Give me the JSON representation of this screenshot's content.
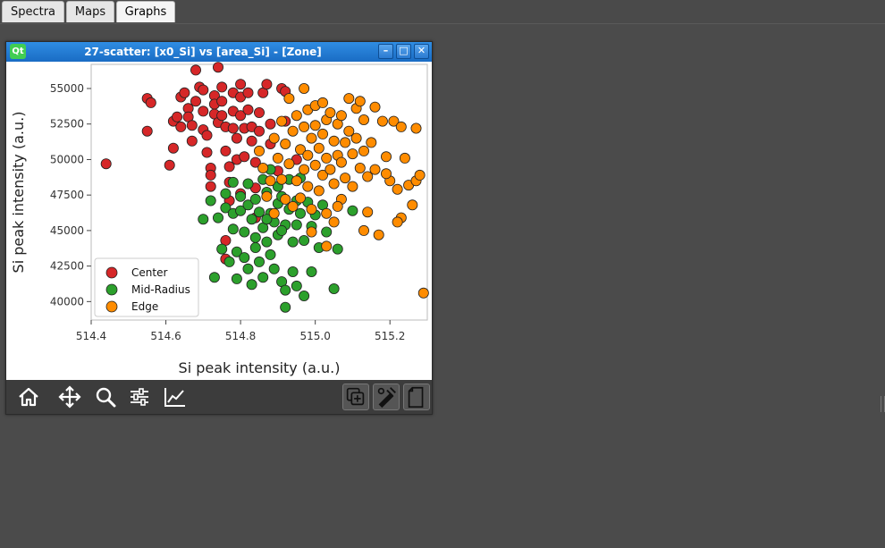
{
  "tabs": [
    {
      "label": "Spectra"
    },
    {
      "label": "Maps"
    },
    {
      "label": "Graphs",
      "active": true
    }
  ],
  "window": {
    "logo": "Qt",
    "title": "27-scatter: [x0_Si] vs [area_Si] - [Zone]",
    "controls": {
      "minimize": "–",
      "maximize": "□",
      "close": "✕"
    }
  },
  "toolbar": {
    "icons": [
      "home-icon",
      "pan-icon",
      "zoom-icon",
      "configure-subplots-icon",
      "edit-curve-icon",
      "copy-figure-icon",
      "customize-icon",
      "clipboard-icon"
    ]
  },
  "colors": {
    "center": "#d62728",
    "mid_radius": "#2ca02c",
    "edge": "#ff8c00",
    "titlebar": "#1f78d1"
  },
  "chart_data": {
    "type": "scatter",
    "xlabel": "Si peak intensity (a.u.)",
    "ylabel": "Si peak intensity (a.u.)",
    "xlim": [
      514.4,
      515.3
    ],
    "ylim": [
      38700,
      56700
    ],
    "xticks": [
      "514.4",
      "514.6",
      "514.8",
      "515.0",
      "515.2"
    ],
    "yticks": [
      "40000",
      "42500",
      "45000",
      "47500",
      "50000",
      "52500",
      "55000"
    ],
    "legend_position": "lower-left",
    "series": [
      {
        "name": "Center",
        "color": "#d62728",
        "points": [
          [
            514.44,
            49700
          ],
          [
            514.55,
            54300
          ],
          [
            514.56,
            54000
          ],
          [
            514.55,
            52000
          ],
          [
            514.61,
            49600
          ],
          [
            514.62,
            52700
          ],
          [
            514.63,
            53000
          ],
          [
            514.62,
            50800
          ],
          [
            514.64,
            54400
          ],
          [
            514.65,
            54700
          ],
          [
            514.64,
            52300
          ],
          [
            514.66,
            53600
          ],
          [
            514.66,
            53000
          ],
          [
            514.67,
            52400
          ],
          [
            514.67,
            51300
          ],
          [
            514.68,
            54100
          ],
          [
            514.68,
            56300
          ],
          [
            514.69,
            55100
          ],
          [
            514.7,
            54900
          ],
          [
            514.7,
            53400
          ],
          [
            514.7,
            52100
          ],
          [
            514.71,
            51700
          ],
          [
            514.71,
            50500
          ],
          [
            514.72,
            49400
          ],
          [
            514.72,
            48900
          ],
          [
            514.72,
            48100
          ],
          [
            514.73,
            54500
          ],
          [
            514.73,
            53900
          ],
          [
            514.73,
            53200
          ],
          [
            514.74,
            52600
          ],
          [
            514.74,
            56500
          ],
          [
            514.75,
            55100
          ],
          [
            514.75,
            54100
          ],
          [
            514.75,
            53100
          ],
          [
            514.76,
            52300
          ],
          [
            514.76,
            50600
          ],
          [
            514.76,
            44300
          ],
          [
            514.77,
            49500
          ],
          [
            514.77,
            48400
          ],
          [
            514.77,
            47100
          ],
          [
            514.78,
            54700
          ],
          [
            514.78,
            53400
          ],
          [
            514.78,
            52200
          ],
          [
            514.79,
            51500
          ],
          [
            514.79,
            50000
          ],
          [
            514.8,
            55300
          ],
          [
            514.8,
            54400
          ],
          [
            514.8,
            53100
          ],
          [
            514.81,
            52200
          ],
          [
            514.81,
            50200
          ],
          [
            514.82,
            54700
          ],
          [
            514.82,
            53500
          ],
          [
            514.83,
            52300
          ],
          [
            514.83,
            51300
          ],
          [
            514.84,
            49800
          ],
          [
            514.84,
            48000
          ],
          [
            514.85,
            53300
          ],
          [
            514.85,
            52000
          ],
          [
            514.86,
            54700
          ],
          [
            514.87,
            55300
          ],
          [
            514.88,
            52500
          ],
          [
            514.88,
            51100
          ],
          [
            514.9,
            49200
          ],
          [
            514.91,
            55000
          ],
          [
            514.92,
            54800
          ],
          [
            514.92,
            52700
          ],
          [
            514.76,
            43000
          ],
          [
            514.8,
            47600
          ],
          [
            514.84,
            45900
          ],
          [
            514.95,
            50000
          ]
        ]
      },
      {
        "name": "Mid-Radius",
        "color": "#2ca02c",
        "points": [
          [
            514.7,
            45800
          ],
          [
            514.72,
            47100
          ],
          [
            514.73,
            41700
          ],
          [
            514.74,
            45900
          ],
          [
            514.75,
            43700
          ],
          [
            514.76,
            47600
          ],
          [
            514.76,
            46600
          ],
          [
            514.77,
            42800
          ],
          [
            514.78,
            48400
          ],
          [
            514.78,
            46200
          ],
          [
            514.78,
            45100
          ],
          [
            514.79,
            41600
          ],
          [
            514.79,
            43500
          ],
          [
            514.8,
            47400
          ],
          [
            514.8,
            46400
          ],
          [
            514.81,
            44900
          ],
          [
            514.81,
            43100
          ],
          [
            514.82,
            48300
          ],
          [
            514.82,
            46800
          ],
          [
            514.82,
            42300
          ],
          [
            514.83,
            45800
          ],
          [
            514.83,
            41200
          ],
          [
            514.84,
            47200
          ],
          [
            514.84,
            44500
          ],
          [
            514.84,
            43800
          ],
          [
            514.85,
            46300
          ],
          [
            514.85,
            42800
          ],
          [
            514.86,
            48600
          ],
          [
            514.86,
            45200
          ],
          [
            514.86,
            41700
          ],
          [
            514.87,
            47700
          ],
          [
            514.87,
            44200
          ],
          [
            514.88,
            46200
          ],
          [
            514.88,
            43300
          ],
          [
            514.88,
            49300
          ],
          [
            514.89,
            45600
          ],
          [
            514.89,
            42300
          ],
          [
            514.9,
            48100
          ],
          [
            514.9,
            46900
          ],
          [
            514.9,
            44700
          ],
          [
            514.91,
            47400
          ],
          [
            514.91,
            41400
          ],
          [
            514.92,
            45400
          ],
          [
            514.92,
            40800
          ],
          [
            514.92,
            39600
          ],
          [
            514.93,
            48600
          ],
          [
            514.93,
            46500
          ],
          [
            514.94,
            44200
          ],
          [
            514.94,
            42100
          ],
          [
            514.95,
            47100
          ],
          [
            514.95,
            45400
          ],
          [
            514.95,
            41100
          ],
          [
            514.96,
            46200
          ],
          [
            514.97,
            44300
          ],
          [
            514.97,
            40400
          ],
          [
            514.98,
            47000
          ],
          [
            514.99,
            45300
          ],
          [
            514.99,
            42100
          ],
          [
            515.0,
            46100
          ],
          [
            515.01,
            43800
          ],
          [
            515.02,
            46800
          ],
          [
            515.03,
            44900
          ],
          [
            515.05,
            40900
          ],
          [
            515.06,
            43700
          ],
          [
            515.1,
            46400
          ],
          [
            514.96,
            48700
          ],
          [
            514.91,
            45000
          ],
          [
            514.87,
            45800
          ]
        ]
      },
      {
        "name": "Edge",
        "color": "#ff8c00",
        "points": [
          [
            514.85,
            50600
          ],
          [
            514.86,
            49400
          ],
          [
            514.87,
            47400
          ],
          [
            514.88,
            48500
          ],
          [
            514.89,
            51500
          ],
          [
            514.89,
            46200
          ],
          [
            514.9,
            50100
          ],
          [
            514.91,
            52700
          ],
          [
            514.91,
            48600
          ],
          [
            514.92,
            47200
          ],
          [
            514.92,
            51100
          ],
          [
            514.93,
            49700
          ],
          [
            514.93,
            54300
          ],
          [
            514.94,
            52000
          ],
          [
            514.94,
            46700
          ],
          [
            514.95,
            48500
          ],
          [
            514.95,
            53100
          ],
          [
            514.96,
            50700
          ],
          [
            514.96,
            47300
          ],
          [
            514.97,
            52300
          ],
          [
            514.97,
            49300
          ],
          [
            514.97,
            55000
          ],
          [
            514.98,
            53500
          ],
          [
            514.98,
            50300
          ],
          [
            514.98,
            48100
          ],
          [
            514.99,
            51500
          ],
          [
            514.99,
            46500
          ],
          [
            515.0,
            53800
          ],
          [
            515.0,
            49600
          ],
          [
            515.0,
            52400
          ],
          [
            515.01,
            50800
          ],
          [
            515.01,
            47800
          ],
          [
            515.02,
            54000
          ],
          [
            515.02,
            51800
          ],
          [
            515.02,
            48900
          ],
          [
            515.03,
            52800
          ],
          [
            515.03,
            50100
          ],
          [
            515.03,
            46200
          ],
          [
            515.04,
            53300
          ],
          [
            515.04,
            49300
          ],
          [
            515.05,
            51300
          ],
          [
            515.05,
            48300
          ],
          [
            515.05,
            45600
          ],
          [
            515.06,
            52500
          ],
          [
            515.06,
            50300
          ],
          [
            515.07,
            49800
          ],
          [
            515.07,
            47200
          ],
          [
            515.07,
            53100
          ],
          [
            515.08,
            51200
          ],
          [
            515.08,
            48700
          ],
          [
            515.09,
            54300
          ],
          [
            515.09,
            52000
          ],
          [
            515.1,
            50400
          ],
          [
            515.1,
            48100
          ],
          [
            515.11,
            53600
          ],
          [
            515.11,
            51500
          ],
          [
            515.12,
            49400
          ],
          [
            515.12,
            54100
          ],
          [
            515.13,
            52800
          ],
          [
            515.13,
            50600
          ],
          [
            515.14,
            48800
          ],
          [
            515.14,
            46300
          ],
          [
            515.15,
            51200
          ],
          [
            515.16,
            49300
          ],
          [
            515.17,
            44700
          ],
          [
            515.18,
            52700
          ],
          [
            515.19,
            50200
          ],
          [
            515.2,
            48500
          ],
          [
            515.21,
            52700
          ],
          [
            515.22,
            47900
          ],
          [
            515.23,
            45900
          ],
          [
            515.23,
            52300
          ],
          [
            515.24,
            50100
          ],
          [
            515.25,
            48200
          ],
          [
            515.26,
            46800
          ],
          [
            515.27,
            52200
          ],
          [
            515.27,
            48500
          ],
          [
            515.28,
            48900
          ],
          [
            515.29,
            40600
          ],
          [
            515.19,
            49000
          ],
          [
            515.06,
            46700
          ],
          [
            514.99,
            44900
          ],
          [
            515.03,
            43900
          ],
          [
            515.13,
            45000
          ],
          [
            515.16,
            53700
          ],
          [
            515.22,
            45600
          ]
        ]
      }
    ]
  }
}
